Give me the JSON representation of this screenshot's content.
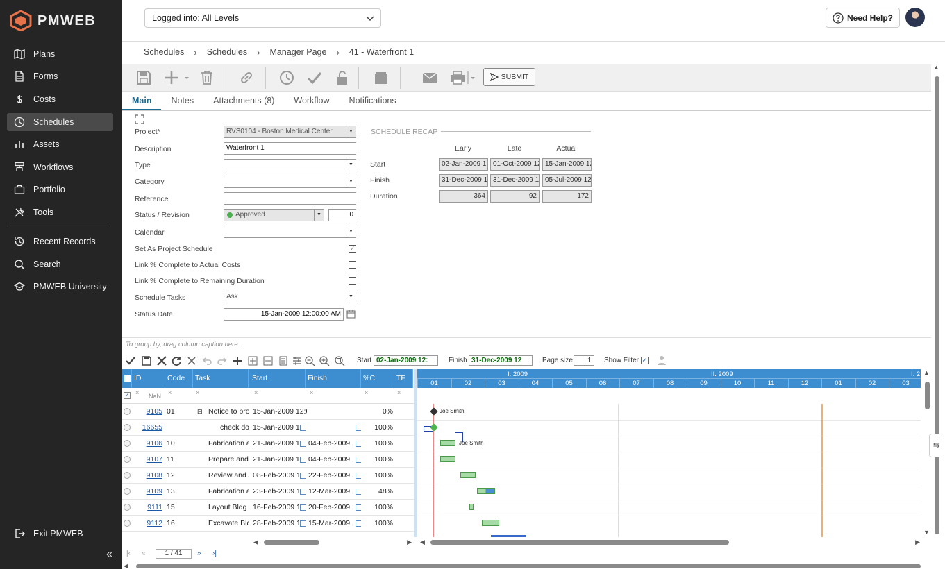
{
  "app": {
    "logo": "PMWEB"
  },
  "sidebar": {
    "items": [
      {
        "label": "Plans",
        "icon": "map-icon"
      },
      {
        "label": "Forms",
        "icon": "document-icon"
      },
      {
        "label": "Costs",
        "icon": "dollar-icon"
      },
      {
        "label": "Schedules",
        "icon": "clock-icon"
      },
      {
        "label": "Assets",
        "icon": "bar-chart-icon"
      },
      {
        "label": "Workflows",
        "icon": "workflow-icon"
      },
      {
        "label": "Portfolio",
        "icon": "briefcase-icon"
      },
      {
        "label": "Tools",
        "icon": "tools-icon"
      }
    ],
    "secondary": [
      {
        "label": "Recent Records",
        "icon": "history-icon"
      },
      {
        "label": "Search",
        "icon": "search-icon"
      },
      {
        "label": "PMWEB University",
        "icon": "graduation-cap-icon"
      }
    ],
    "exit": "Exit PMWEB",
    "collapse": "«"
  },
  "header": {
    "login_level": "Logged into: All Levels",
    "help": "Need Help?"
  },
  "breadcrumb": [
    "Schedules",
    "Schedules",
    "Manager Page",
    "41 - Waterfront 1"
  ],
  "toolbar": {
    "submit": "SUBMIT"
  },
  "tabs": [
    "Main",
    "Notes",
    "Attachments (8)",
    "Workflow",
    "Notifications"
  ],
  "form": {
    "project_label": "Project*",
    "project_value": "RVS0104 - Boston Medical Center",
    "description_label": "Description",
    "description_value": "Waterfront 1",
    "type_label": "Type",
    "category_label": "Category",
    "reference_label": "Reference",
    "status_label": "Status / Revision",
    "status_value": "Approved",
    "revision_value": "0",
    "calendar_label": "Calendar",
    "set_project_label": "Set As Project Schedule",
    "link_actual_label": "Link % Complete to Actual Costs",
    "link_remaining_label": "Link % Complete to Remaining Duration",
    "schedule_tasks_label": "Schedule Tasks",
    "schedule_tasks_value": "Ask",
    "status_date_label": "Status Date",
    "status_date_value": "15-Jan-2009 12:00:00 AM",
    "status_color": "#4caf50"
  },
  "recap": {
    "title": "SCHEDULE RECAP",
    "headers": [
      "Early",
      "Late",
      "Actual"
    ],
    "rows": [
      {
        "label": "Start",
        "values": [
          "02-Jan-2009 1",
          "01-Oct-2009 12",
          "15-Jan-2009 12"
        ]
      },
      {
        "label": "Finish",
        "values": [
          "31-Dec-2009 1",
          "31-Dec-2009 1",
          "05-Jul-2009 12"
        ]
      },
      {
        "label": "Duration",
        "values": [
          "364",
          "92",
          "172"
        ]
      }
    ]
  },
  "grid": {
    "group_hint": "To group by, drag column caption here ...",
    "start_label": "Start",
    "start_value": "02-Jan-2009 12:",
    "finish_label": "Finish",
    "finish_value": "31-Dec-2009 12",
    "page_size_label": "Page size",
    "page_size_value": "1",
    "show_filter_label": "Show Filter",
    "columns": [
      "ID",
      "Code",
      "Task",
      "Start",
      "Finish",
      "%C",
      "TF"
    ],
    "filter_nan": "NaN",
    "rows": [
      {
        "id": "9105",
        "code": "01",
        "task": "Notice to pro",
        "start": "15-Jan-2009 12:00",
        "finish": "",
        "pc": "0%"
      },
      {
        "id": "16655",
        "code": "",
        "task": "check doc",
        "start": "15-Jan-2009 1:",
        "finish": "",
        "pc": "100%"
      },
      {
        "id": "9106",
        "code": "10",
        "task": "Fabrication an",
        "start": "21-Jan-2009 1:",
        "finish": "04-Feb-2009 1",
        "pc": "100%"
      },
      {
        "id": "9107",
        "code": "11",
        "task": "Prepare and I",
        "start": "21-Jan-2009 1:",
        "finish": "04-Feb-2009 1",
        "pc": "100%"
      },
      {
        "id": "9108",
        "code": "12",
        "task": "Review and A",
        "start": "08-Feb-2009 1:",
        "finish": "22-Feb-2009 1",
        "pc": "100%"
      },
      {
        "id": "9109",
        "code": "13",
        "task": "Fabrication an",
        "start": "23-Feb-2009 1:",
        "finish": "12-Mar-2009 1",
        "pc": "48%"
      },
      {
        "id": "9111",
        "code": "15",
        "task": "Layout Bldg F",
        "start": "16-Feb-2009 1:",
        "finish": "20-Feb-2009 1",
        "pc": "100%"
      },
      {
        "id": "9112",
        "code": "16",
        "task": "Excavate Bldg",
        "start": "28-Feb-2009 1:",
        "finish": "15-Mar-2009 1",
        "pc": "100%"
      }
    ],
    "pager": "1 / 41"
  },
  "gantt": {
    "periods": [
      "I. 2009",
      "II. 2009",
      "I. 2"
    ],
    "months": [
      "01",
      "02",
      "03",
      "04",
      "05",
      "06",
      "07",
      "08",
      "09",
      "10",
      "11",
      "12",
      "01",
      "02",
      "03"
    ],
    "resource_label_1": "Joe Smith",
    "resource_label_2": "Joe Smith"
  }
}
